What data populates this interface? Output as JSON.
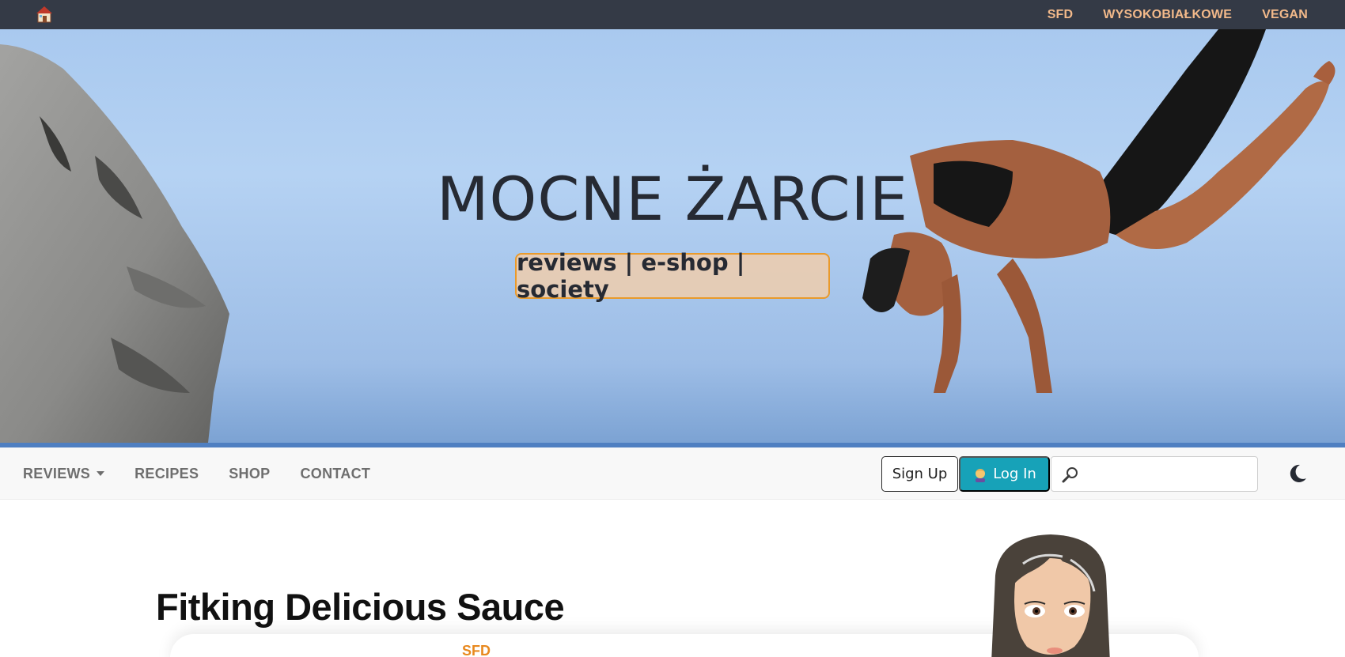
{
  "topbar": {
    "home_icon": "home-icon",
    "links": [
      "SFD",
      "WYSOKOBIAŁKOWE",
      "VEGAN"
    ],
    "link_color": "#f2b98a",
    "background": "#343a46"
  },
  "hero": {
    "title": "MOCNE ŻARCIE",
    "subtitle": "reviews | e-shop | society",
    "accent": "#e99a2c"
  },
  "nav": {
    "items": [
      {
        "label": "REVIEWS",
        "has_dropdown": true
      },
      {
        "label": "RECIPES"
      },
      {
        "label": "SHOP"
      },
      {
        "label": "CONTACT"
      }
    ],
    "signup_label": "Sign Up",
    "login_label": "Log In",
    "login_color": "#17a2b8",
    "search": {
      "placeholder": "",
      "value": "",
      "icon": "search-icon"
    },
    "theme_toggle_icon": "moon-icon"
  },
  "article": {
    "title": "Fitking Delicious Sauce",
    "category": "SFD",
    "category_color": "#e8891f",
    "avatar_icon": "avatar"
  }
}
